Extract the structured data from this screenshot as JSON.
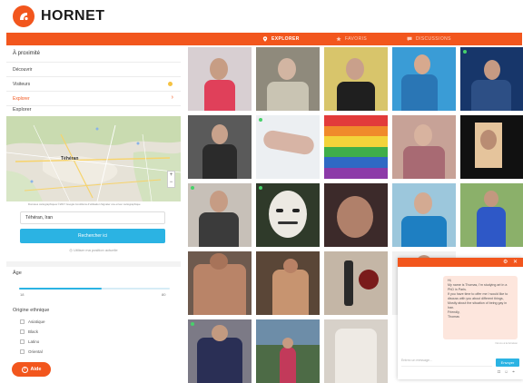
{
  "header": {
    "brand": "HORNET"
  },
  "nav": {
    "items": [
      {
        "label": "EXPLORER",
        "state": "active"
      },
      {
        "label": "FAVORIS",
        "state": "dim"
      },
      {
        "label": "DISCUSSIONS",
        "state": "dim"
      }
    ]
  },
  "sidebar": {
    "title": "À proximité",
    "rows": [
      {
        "label": "Découvrir"
      },
      {
        "label": "Visiteurs"
      },
      {
        "label": "Explorer"
      }
    ],
    "explore_label": "Explorer",
    "map_city": "Téhéran",
    "map_credit": "Données cartographiques ©2017 Google   Conditions d'utilisation   Signaler une erreur cartographique",
    "location_value": "Téhéran, Iran",
    "search_button": "Rechercher ici",
    "use_location": "◎ Utiliser ma position actuelle",
    "age": {
      "title": "Âge",
      "min": "18",
      "max": "80",
      "fill_fraction": 0.55
    },
    "ethnicity": {
      "title": "Origine ethnique",
      "items": [
        "Asiatique",
        "Black",
        "Latino",
        "Oriental"
      ]
    },
    "help_button": "Aide"
  },
  "chat": {
    "message": "Hi,\nMy name is Thomas, I'm studying art in a PhD in Paris.\nIf you have time to offer me I would like to discuss with you about different things, Mostly about the situation of being gay in Iran.\nFriendly,\nThomas",
    "meta": "Non-lu à la livraison",
    "placeholder": "Entrez un message...",
    "send_label": "Envoyer"
  },
  "colors": {
    "accent": "#f2561d",
    "primary": "#2bb3e3",
    "online": "#47d16a"
  }
}
